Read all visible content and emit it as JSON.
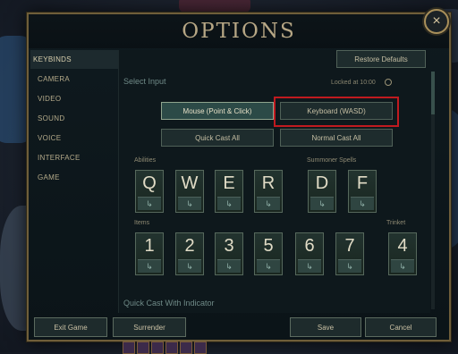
{
  "title": "OPTIONS",
  "close_icon": "×",
  "sidebar": {
    "items": [
      {
        "label": "KEYBINDS",
        "active": true
      },
      {
        "label": "CAMERA"
      },
      {
        "label": "VIDEO"
      },
      {
        "label": "SOUND"
      },
      {
        "label": "VOICE"
      },
      {
        "label": "INTERFACE"
      },
      {
        "label": "GAME"
      }
    ]
  },
  "restore_defaults": "Restore Defaults",
  "select_input_label": "Select Input",
  "locked_text": "Locked at 10:00",
  "lock_icon": "clock-icon",
  "input_modes": {
    "mouse": "Mouse (Point & Click)",
    "keyboard": "Keyboard (WASD)"
  },
  "cast_buttons": {
    "quick": "Quick Cast All",
    "normal": "Normal Cast All"
  },
  "labels": {
    "abilities": "Abilities",
    "summoner": "Summoner Spells",
    "items": "Items",
    "trinket": "Trinket"
  },
  "ability_keys": [
    "Q",
    "W",
    "E",
    "R"
  ],
  "summoner_keys": [
    "D",
    "F"
  ],
  "item_keys": [
    "1",
    "2",
    "3",
    "5",
    "6",
    "7"
  ],
  "trinket_key": "4",
  "key_sub_glyph": "↳",
  "quick_cast_indicator": "Quick Cast With Indicator",
  "footer": {
    "exit": "Exit Game",
    "surrender": "Surrender",
    "save": "Save",
    "cancel": "Cancel"
  },
  "colors": {
    "gold_border": "#6f5e3a",
    "highlight_red": "#c01a1f",
    "selected_teal": "#2c4a47"
  }
}
